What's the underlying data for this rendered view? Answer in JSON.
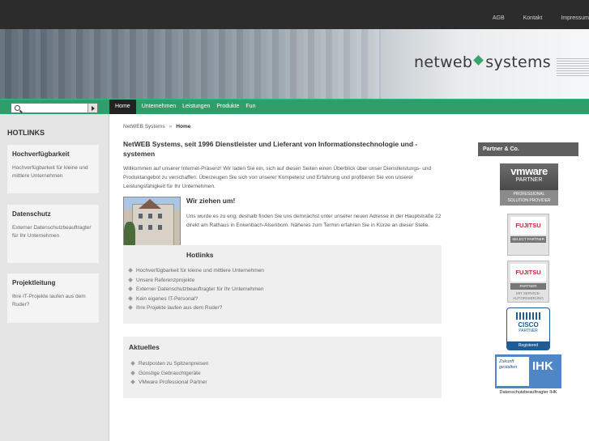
{
  "toplinks": [
    "AGB",
    "Kontakt",
    "Impressum"
  ],
  "logo": {
    "left": "netweb",
    "right": "systems"
  },
  "search": {
    "placeholder": ""
  },
  "menu": [
    "Home",
    "Unternehmen",
    "Leistungen",
    "Produkte",
    "Fun"
  ],
  "sidebar": {
    "heading": "HOTLINKS",
    "boxes": [
      {
        "title": "Hochverfügbarkeit",
        "text": "Hochverfügbarkeit für kleine und mittlere Unternehmen"
      },
      {
        "title": "Datenschutz",
        "text": "Externer Datenschutzbeauftragter für Ihr Unternehmen"
      },
      {
        "title": "Projektleitung",
        "text": "Ihre IT-Projekte laufen aus dem Ruder?"
      }
    ]
  },
  "breadcrumb": {
    "root": "NetWEB Systems",
    "sep": "»",
    "current": "Home"
  },
  "main": {
    "title": "NetWEB Systems, seit 1996 Dienstleister und Lieferant von Informationstechnologie und -systemen",
    "intro": "Willkommen auf unserer Internet-Präsenz! Wir laden Sie ein, sich auf diesen Seiten einen Überblick über unser Dienstleistungs- und Produktangebot zu verschaffen. Überzeugen Sie sich von unserer Kompetenz und Erfahrung und profitieren Sie von unserer Leistungsfähigkeit für Ihr Unternehmen.",
    "move_heading": "Wir ziehen um!",
    "move_text": "Uns wurde es zu eng, deshalb finden Sie uns demnächst unter unserer neuen Adresse in der Hauptstraße 22 direkt am Rathaus in Enkenbach-Alsenborn. Näheres zum Termin erfahren Sie in Kürze an dieser Stelle.",
    "hotlinks": {
      "title": "Hotlinks",
      "items": [
        "Hochverfügbarkeit für kleine und mittlere Unternehmen",
        "Unsere Referenzprojekte",
        "Externer Datenschutzbeauftragter für Ihr Unternehmen",
        "Kein eigenes IT-Personal?",
        "Ihre Projekte laufen aus dem Ruder?"
      ]
    },
    "aktuelles": {
      "title": "Aktuelles",
      "items": [
        "Restposten zu Spitzenpreisen",
        "Günstige Gebrauchtgeräte",
        "VMware Professional Partner"
      ]
    }
  },
  "partners": {
    "heading": "Partner & Co.",
    "vmware": {
      "brand": "vmware",
      "partner": "PARTNER",
      "sub1": "PROFESSIONAL",
      "sub2": "SOLUTION PROVIDER"
    },
    "fujitsu1": {
      "brand": "FUJITSU",
      "label": "SELECT PARTNER"
    },
    "fujitsu2": {
      "brand": "FUJITSU",
      "label": "PARTNER",
      "sub": "MIT SERVICE-AUTORISIERUNG"
    },
    "cisco": {
      "brand": "CISCO",
      "partner": "PARTNER",
      "status": "Registered"
    },
    "ihk": {
      "tagline": "Zukunft gestalten",
      "brand": "IHK",
      "caption": "Datenschutzbeauftragter IHK"
    }
  }
}
